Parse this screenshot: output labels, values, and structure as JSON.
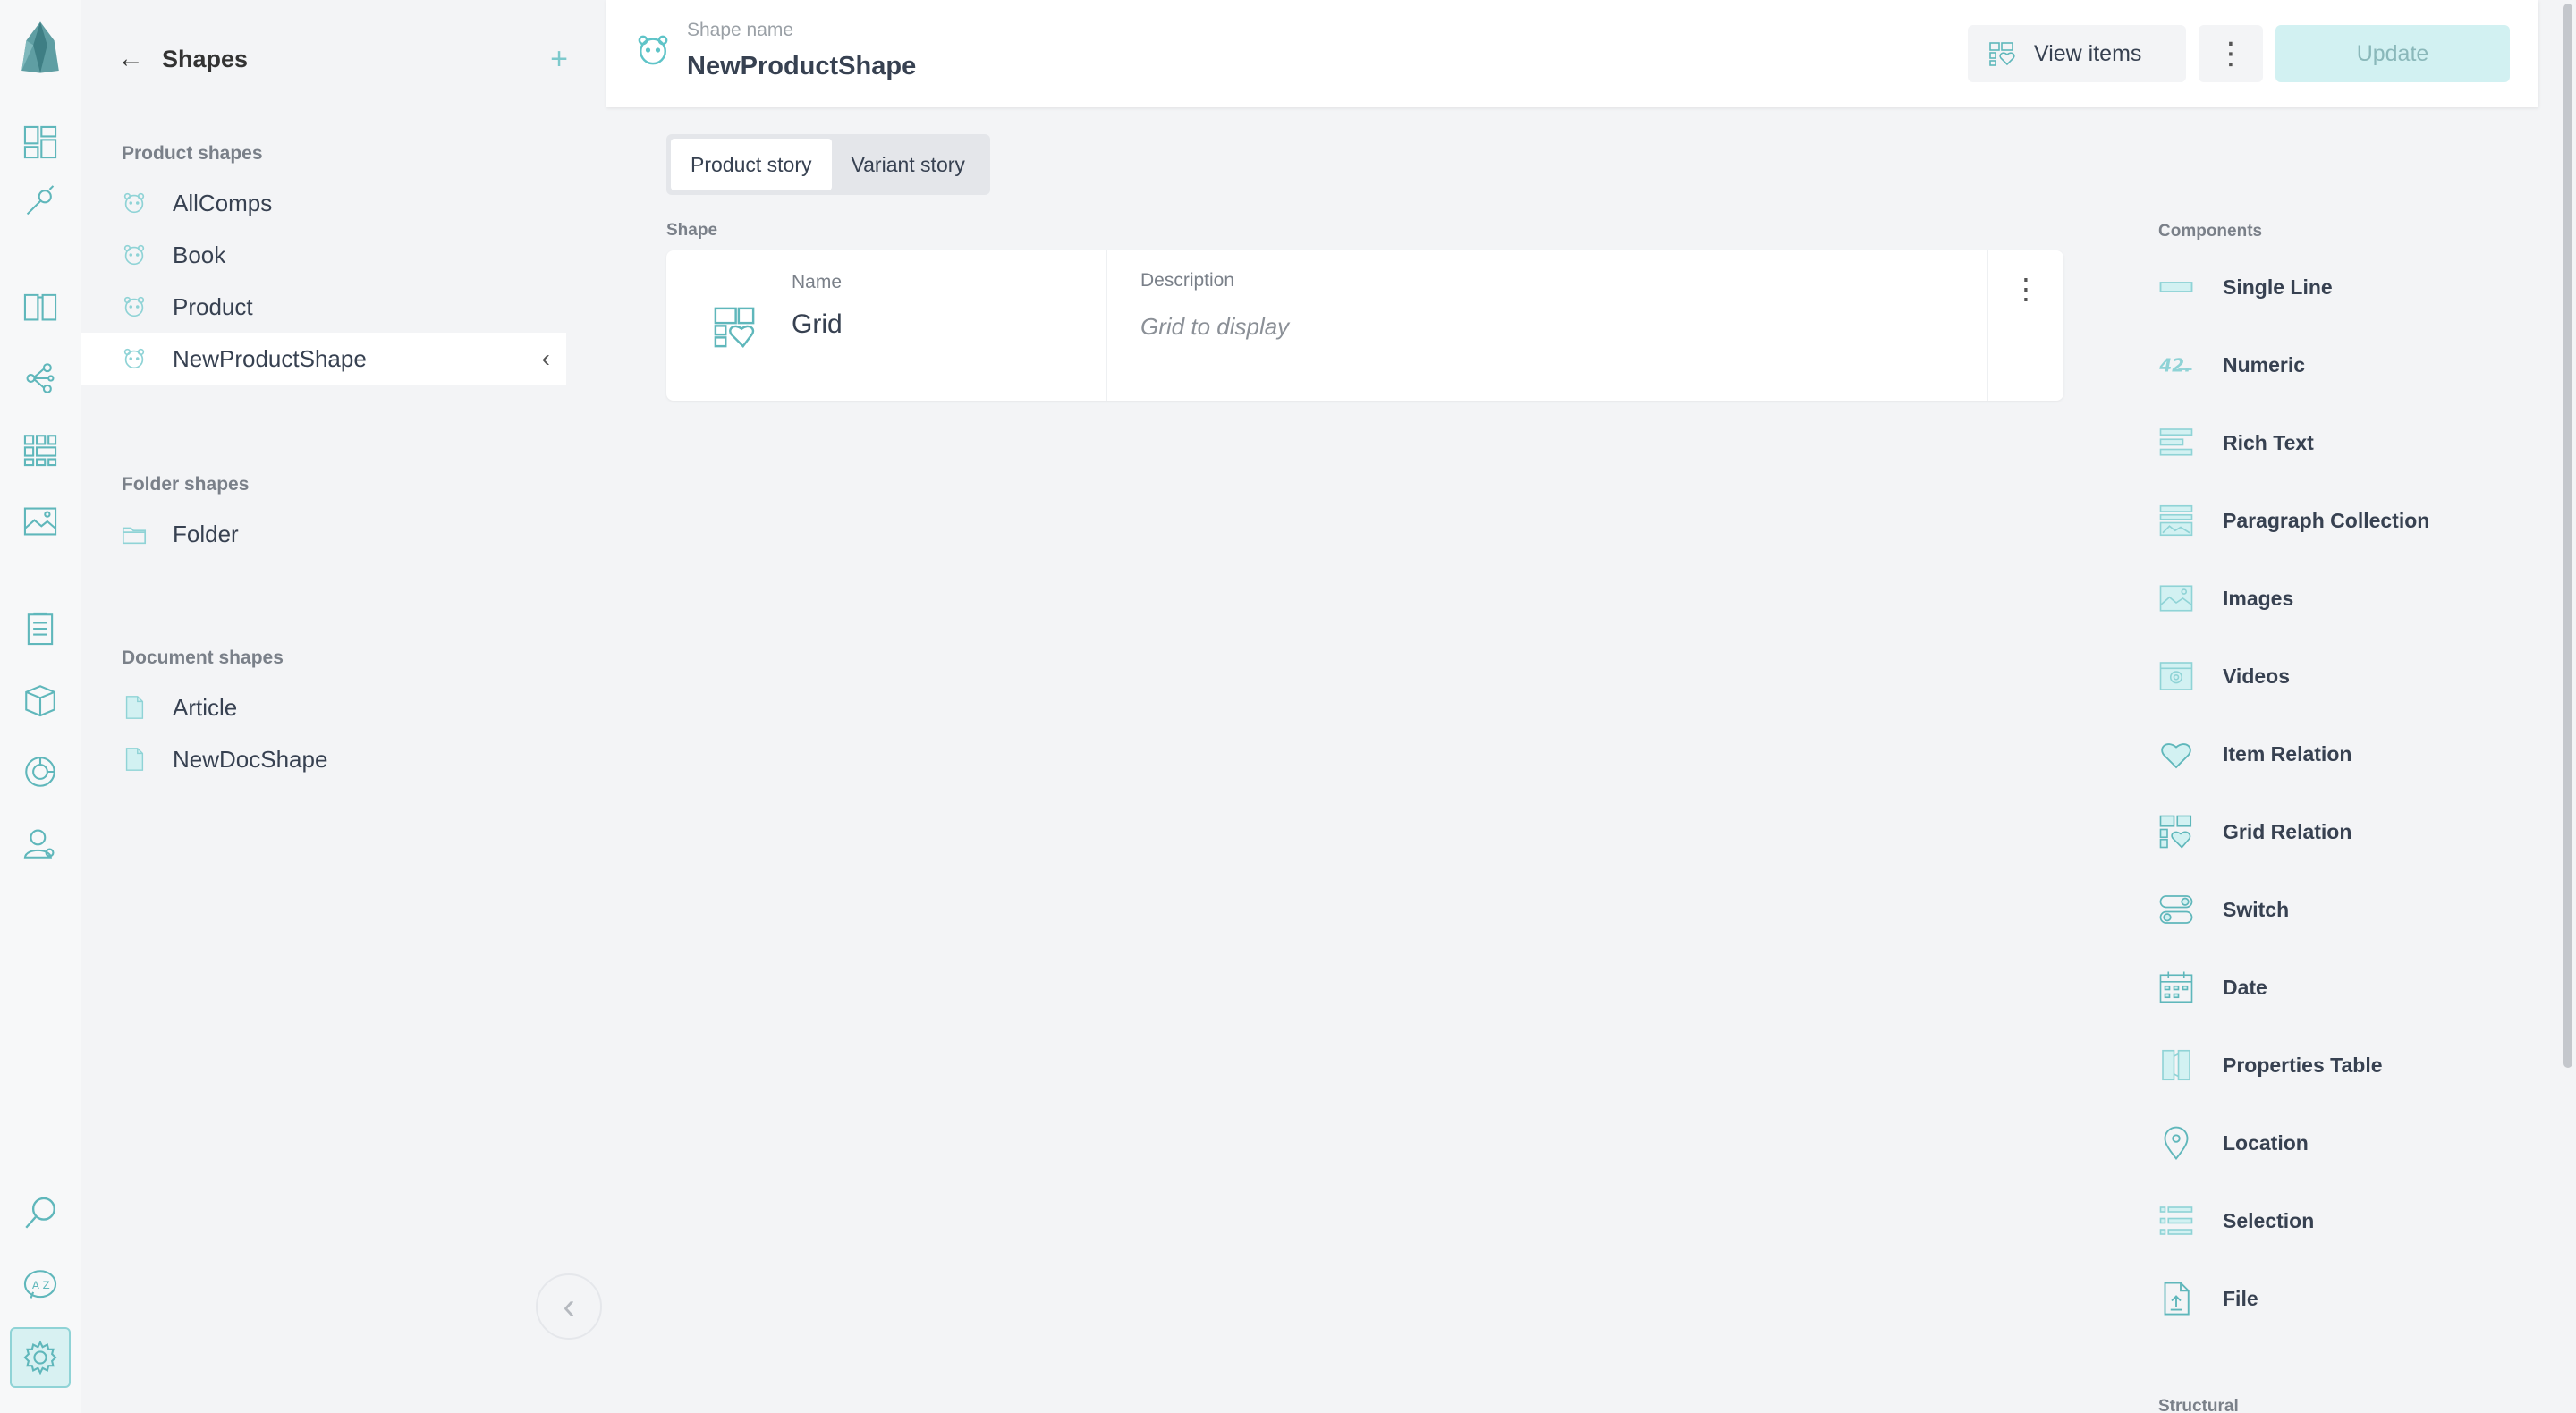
{
  "sidebar": {
    "title": "Shapes",
    "groups": [
      {
        "label": "Product shapes",
        "items": [
          "AllComps",
          "Book",
          "Product",
          "NewProductShape"
        ]
      },
      {
        "label": "Folder shapes",
        "items": [
          "Folder"
        ]
      },
      {
        "label": "Document shapes",
        "items": [
          "Article",
          "NewDocShape"
        ]
      }
    ],
    "selected": "NewProductShape"
  },
  "header": {
    "label": "Shape name",
    "name": "NewProductShape",
    "view_items": "View items",
    "update": "Update"
  },
  "tabs": [
    "Product story",
    "Variant story"
  ],
  "shape": {
    "section_label": "Shape",
    "name_label": "Name",
    "name_value": "Grid",
    "description_label": "Description",
    "description_placeholder": "Grid to display"
  },
  "components": {
    "heading": "Components",
    "items": [
      "Single Line",
      "Numeric",
      "Rich Text",
      "Paragraph Collection",
      "Images",
      "Videos",
      "Item Relation",
      "Grid Relation",
      "Switch",
      "Date",
      "Properties Table",
      "Location",
      "Selection",
      "File"
    ],
    "structural_heading": "Structural"
  },
  "colors": {
    "accent": "#5fc4c8",
    "accent_light": "#d2f1f2"
  }
}
